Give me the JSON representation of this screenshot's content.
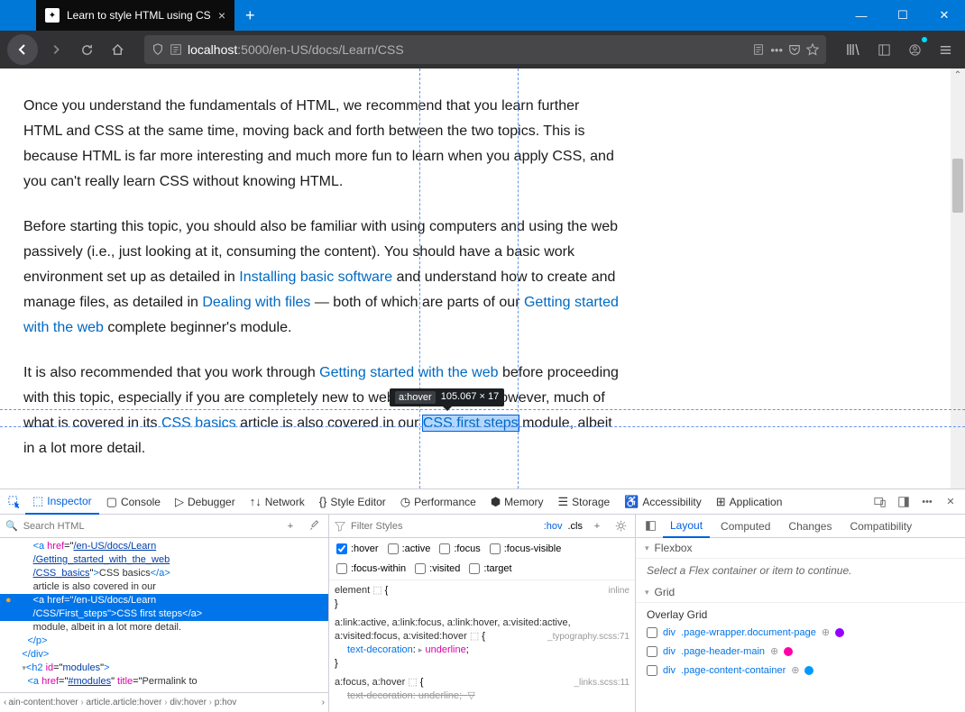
{
  "window": {
    "tab_title": "Learn to style HTML using CSS",
    "url_host": "localhost",
    "url_port_path": ":5000/en-US/docs/Learn/CSS"
  },
  "content": {
    "p1": "Once you understand the fundamentals of HTML, we recommend that you learn further HTML and CSS at the same time, moving back and forth between the two topics. This is because HTML is far more interesting and much more fun to learn when you apply CSS, and you can't really learn CSS without knowing HTML.",
    "p2a": "Before starting this topic, you should also be familiar with using computers and using the web passively (i.e., just looking at it, consuming the content). You should have a basic work environment set up as detailed in ",
    "link_install": "Installing basic software",
    "p2b": " and understand how to create and manage files, as detailed in ",
    "link_files": "Dealing with files",
    "p2c": " — both of which are parts of our ",
    "link_getting": "Getting started with the web",
    "p2d": " complete beginner's module.",
    "p3a": "It is also recommended that you work through ",
    "link_getting2": "Getting started with the web",
    "p3b": " before proceeding with this topic, especially if you are completely new to web development. However, much of what is covered in its ",
    "link_cssbasics": "CSS basics",
    "p3c": " article is also covered in our ",
    "link_firststeps": "CSS first steps",
    "p3d": " module, albeit in a lot more detail."
  },
  "tooltip": {
    "tag": "a:hover",
    "dims": "105.067 × 17"
  },
  "devtools": {
    "tabs": [
      "Inspector",
      "Console",
      "Debugger",
      "Network",
      "Style Editor",
      "Performance",
      "Memory",
      "Storage",
      "Accessibility",
      "Application"
    ],
    "search_placeholder": "Search HTML",
    "filter_placeholder": "Filter Styles",
    "hov_label": ":hov",
    "cls_label": ".cls",
    "pseudo": [
      ":hover",
      ":active",
      ":focus",
      ":focus-visible",
      ":focus-within",
      ":visited",
      ":target"
    ],
    "element_label": "element",
    "inline_label": "inline",
    "rule1_sel": "a:link:active, a:link:focus, a:link:hover, a:visited:active, a:visited:focus, a:visited:hover",
    "rule1_src": "_typography.scss:71",
    "rule1_prop": "text-decoration",
    "rule1_val": "underline",
    "rule2_sel": "a:focus, a:hover",
    "rule2_src": "_links.scss:11",
    "rule2_prop": "text-decoration",
    "rule2_val": "underline",
    "side_tabs": [
      "Layout",
      "Computed",
      "Changes",
      "Compatibility"
    ],
    "flexbox_hdr": "Flexbox",
    "flexbox_body": "Select a Flex container or item to continue.",
    "grid_hdr": "Grid",
    "overlay_hdr": "Overlay Grid",
    "grid_items": [
      {
        "el": "div",
        "cls": ".page-wrapper.document-page",
        "color": "#9400ff"
      },
      {
        "el": "div",
        "cls": ".page-header-main",
        "color": "#ff00a8"
      },
      {
        "el": "div",
        "cls": ".page-content-container",
        "color": "#0099ff"
      }
    ],
    "crumbs": [
      "ain-content:hover",
      "article.article:hover",
      "div:hover",
      "p:hov"
    ],
    "tree": [
      {
        "indent": 10,
        "html": "<span class='tk-tag'>&lt;a</span> <span class='tk-attr'>href</span>=\"<span class='tk-string'>/en-US/docs/Learn</span>"
      },
      {
        "indent": 10,
        "html": "<span class='tk-string'>/Getting_started_with_the_web</span>"
      },
      {
        "indent": 10,
        "html": "<span class='tk-string'>/CSS_basics</span>\"<span class='tk-tag'>&gt;</span><span class='tk-text'>CSS basics</span><span class='tk-tag'>&lt;/a&gt;</span>"
      },
      {
        "indent": 10,
        "html": "<span class='tk-text'>article is also covered in our </span>"
      },
      {
        "indent": 10,
        "selected": true,
        "dot": true,
        "html": "&lt;a href=\"/en-US/docs/Learn"
      },
      {
        "indent": 10,
        "selected": true,
        "html": "/CSS/First_steps\"&gt;CSS first steps&lt;/a&gt;"
      },
      {
        "indent": 10,
        "html": "<span class='tk-text'>module, albeit in a lot more detail.</span>"
      },
      {
        "indent": 8,
        "html": "<span class='tk-tag'>&lt;/p&gt;</span>"
      },
      {
        "indent": 6,
        "html": "<span class='tk-tag'>&lt;/div&gt;</span>"
      },
      {
        "indent": 6,
        "html": "<span class='tri'>▾</span><span class='tk-tag'>&lt;h2</span> <span class='tk-attr'>id</span>=\"<span class='tk-string' style='text-decoration:none'>modules</span>\"<span class='tk-tag'>&gt;</span>"
      },
      {
        "indent": 8,
        "html": "<span class='tk-tag'>&lt;a</span> <span class='tk-attr'>href</span>=\"<span class='tk-string'>#modules</span>\" <span class='tk-attr'>title</span>=\"<span class='tk-text'>Permalink to</span>"
      }
    ]
  }
}
